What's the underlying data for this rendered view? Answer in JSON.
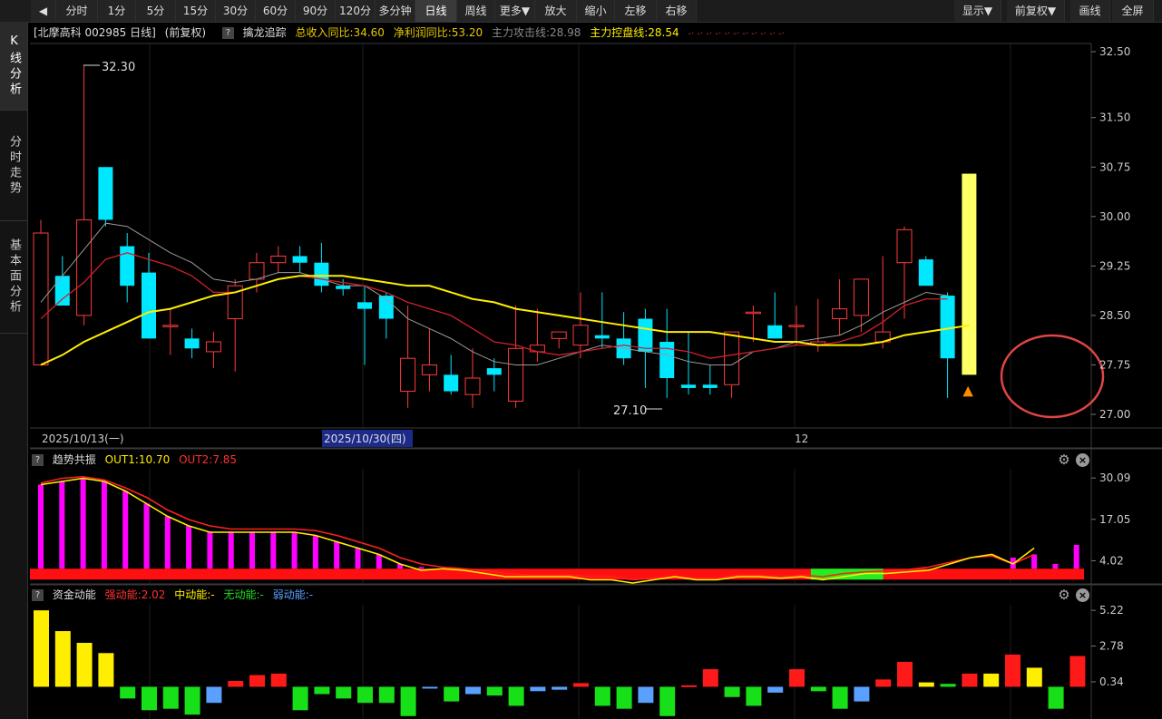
{
  "toolbar": {
    "back": "◀",
    "periods": [
      "分时",
      "1分",
      "5分",
      "15分",
      "30分",
      "60分",
      "90分",
      "120分",
      "多分钟",
      "日线",
      "周线",
      "更多▼"
    ],
    "actions": [
      "放大",
      "缩小",
      "左移",
      "右移"
    ],
    "right": [
      "显示▼",
      "前复权▼",
      "画线",
      "全屏"
    ]
  },
  "sidebar": [
    {
      "label": "K线分析",
      "active": true
    },
    {
      "label": "分时走势",
      "active": false
    },
    {
      "label": "基本面分析",
      "active": false
    }
  ],
  "header": {
    "stock": "[北摩高科 002985 日线]",
    "adjust": "(前复权)",
    "q": "?",
    "indicator": "擒龙追踪",
    "revenue": "总收入同比:34.60",
    "profit": "净利润同比:53.20",
    "attack": "主力攻击线:28.98",
    "control": "主力控盘线:28.54",
    "dots": "-·  -·  -·  -·  -·  -·  -·  -·  -·  -·  -·"
  },
  "colors": {
    "up": "#ff3b3b",
    "down": "#00e8ff",
    "ma_slow": "#ffee00",
    "ma_fast": "#d0202a",
    "ma_mid": "#9a9a9a",
    "highlight": "#ffff66",
    "circle": "#e04545"
  },
  "price_axis": {
    "ticks": [
      "32.50",
      "31.50",
      "30.75",
      "30.00",
      "29.25",
      "28.50",
      "27.75",
      "27.00"
    ],
    "min": 27.0,
    "max": 32.5
  },
  "date_labels": [
    {
      "text": "2025/10/13(一)",
      "highlight": false
    },
    {
      "text": "2025/10/30(四)",
      "highlight": true
    },
    {
      "text": "12",
      "highlight": false
    }
  ],
  "annotations": {
    "high": "32.30",
    "low": "27.10"
  },
  "chart_data": {
    "type": "candlestick",
    "candles": [
      {
        "o": 27.75,
        "h": 29.95,
        "l": 27.75,
        "c": 29.75
      },
      {
        "o": 29.1,
        "h": 29.4,
        "l": 28.75,
        "c": 28.65
      },
      {
        "o": 28.5,
        "h": 32.3,
        "l": 28.35,
        "c": 29.95
      },
      {
        "o": 30.75,
        "h": 30.75,
        "l": 29.85,
        "c": 29.95
      },
      {
        "o": 29.55,
        "h": 29.75,
        "l": 28.7,
        "c": 28.95
      },
      {
        "o": 29.15,
        "h": 29.45,
        "l": 28.35,
        "c": 28.15
      },
      {
        "o": 28.35,
        "h": 28.6,
        "l": 27.9,
        "c": 28.35
      },
      {
        "o": 28.15,
        "h": 28.3,
        "l": 27.85,
        "c": 28.0
      },
      {
        "o": 27.95,
        "h": 28.25,
        "l": 27.7,
        "c": 28.1
      },
      {
        "o": 28.45,
        "h": 29.05,
        "l": 27.65,
        "c": 28.95
      },
      {
        "o": 29.05,
        "h": 29.45,
        "l": 28.85,
        "c": 29.3
      },
      {
        "o": 29.3,
        "h": 29.55,
        "l": 29.15,
        "c": 29.4
      },
      {
        "o": 29.4,
        "h": 29.55,
        "l": 29.15,
        "c": 29.3
      },
      {
        "o": 29.3,
        "h": 29.6,
        "l": 28.85,
        "c": 28.95
      },
      {
        "o": 28.95,
        "h": 29.05,
        "l": 28.8,
        "c": 28.9
      },
      {
        "o": 28.7,
        "h": 28.95,
        "l": 27.75,
        "c": 28.6
      },
      {
        "o": 28.8,
        "h": 28.85,
        "l": 28.15,
        "c": 28.45
      },
      {
        "o": 27.35,
        "h": 28.65,
        "l": 27.1,
        "c": 27.85
      },
      {
        "o": 27.6,
        "h": 28.3,
        "l": 27.35,
        "c": 27.75
      },
      {
        "o": 27.6,
        "h": 27.9,
        "l": 27.3,
        "c": 27.35
      },
      {
        "o": 27.3,
        "h": 28.0,
        "l": 27.1,
        "c": 27.55
      },
      {
        "o": 27.7,
        "h": 27.85,
        "l": 27.35,
        "c": 27.6
      },
      {
        "o": 27.2,
        "h": 28.65,
        "l": 27.1,
        "c": 28.0
      },
      {
        "o": 27.95,
        "h": 28.6,
        "l": 27.8,
        "c": 28.05
      },
      {
        "o": 28.15,
        "h": 28.25,
        "l": 28.0,
        "c": 28.25
      },
      {
        "o": 28.05,
        "h": 28.85,
        "l": 27.85,
        "c": 28.35
      },
      {
        "o": 28.2,
        "h": 28.85,
        "l": 28.0,
        "c": 28.15
      },
      {
        "o": 28.15,
        "h": 28.55,
        "l": 27.75,
        "c": 27.85
      },
      {
        "o": 28.45,
        "h": 28.6,
        "l": 27.4,
        "c": 27.95
      },
      {
        "o": 28.1,
        "h": 28.6,
        "l": 27.25,
        "c": 27.55
      },
      {
        "o": 27.45,
        "h": 28.25,
        "l": 27.3,
        "c": 27.4
      },
      {
        "o": 27.45,
        "h": 27.75,
        "l": 27.3,
        "c": 27.4
      },
      {
        "o": 27.45,
        "h": 28.2,
        "l": 27.25,
        "c": 28.25
      },
      {
        "o": 28.55,
        "h": 28.65,
        "l": 28.1,
        "c": 28.55
      },
      {
        "o": 28.35,
        "h": 28.85,
        "l": 28.15,
        "c": 28.15
      },
      {
        "o": 28.35,
        "h": 28.65,
        "l": 28.05,
        "c": 28.35
      },
      {
        "o": 28.05,
        "h": 28.75,
        "l": 27.95,
        "c": 28.1
      },
      {
        "o": 28.45,
        "h": 29.05,
        "l": 28.2,
        "c": 28.6
      },
      {
        "o": 28.5,
        "h": 28.85,
        "l": 28.25,
        "c": 29.05
      },
      {
        "o": 28.1,
        "h": 29.4,
        "l": 28.0,
        "c": 28.25
      },
      {
        "o": 29.3,
        "h": 29.85,
        "l": 28.45,
        "c": 29.8
      },
      {
        "o": 29.35,
        "h": 29.4,
        "l": 28.95,
        "c": 28.95
      },
      {
        "o": 28.8,
        "h": 28.85,
        "l": 27.25,
        "c": 27.85
      }
    ],
    "ma_slow": [
      27.75,
      27.9,
      28.1,
      28.25,
      28.4,
      28.55,
      28.6,
      28.7,
      28.8,
      28.85,
      28.95,
      29.05,
      29.1,
      29.1,
      29.1,
      29.05,
      29.0,
      28.95,
      28.95,
      28.85,
      28.75,
      28.7,
      28.6,
      28.55,
      28.5,
      28.45,
      28.4,
      28.35,
      28.3,
      28.25,
      28.25,
      28.25,
      28.2,
      28.15,
      28.1,
      28.1,
      28.05,
      28.05,
      28.05,
      28.1,
      28.2,
      28.25,
      28.3,
      28.35
    ],
    "ma_fast": [
      28.45,
      28.75,
      29.0,
      29.35,
      29.45,
      29.35,
      29.25,
      29.1,
      28.85,
      28.85,
      28.95,
      29.05,
      29.1,
      29.05,
      29.0,
      28.95,
      28.85,
      28.7,
      28.6,
      28.5,
      28.3,
      28.1,
      28.05,
      27.95,
      27.9,
      27.95,
      28.0,
      28.05,
      28.0,
      28.0,
      27.95,
      27.85,
      27.9,
      27.95,
      28.0,
      28.05,
      28.05,
      28.1,
      28.2,
      28.4,
      28.65,
      28.75,
      28.75
    ],
    "ma_mid": [
      28.7,
      29.1,
      29.5,
      29.9,
      29.85,
      29.65,
      29.45,
      29.3,
      29.05,
      29.0,
      29.05,
      29.15,
      29.15,
      29.05,
      28.95,
      28.95,
      28.75,
      28.45,
      28.3,
      28.15,
      27.95,
      27.8,
      27.75,
      27.75,
      27.85,
      27.95,
      28.05,
      28.0,
      27.95,
      27.9,
      27.8,
      27.75,
      27.75,
      27.95,
      28.0,
      28.1,
      28.15,
      28.2,
      28.35,
      28.55,
      28.7,
      28.85,
      28.8
    ],
    "highlight_bar": {
      "from": 27.6,
      "to": 30.65
    }
  },
  "trend_panel": {
    "q": "?",
    "name": "趋势共振",
    "out1": "OUT1:10.70",
    "out2": "OUT2:7.85",
    "ticks": [
      "30.09",
      "17.05",
      "4.02"
    ],
    "min": -3.0,
    "max": 33.0,
    "bars": [
      28,
      29,
      30,
      29,
      26,
      22,
      18,
      15,
      13,
      13,
      13,
      13,
      13,
      12,
      10,
      8,
      6,
      3,
      2,
      0,
      0,
      0,
      0,
      0,
      0,
      0,
      0,
      0,
      0,
      0,
      0,
      0,
      0,
      0,
      0,
      0,
      0,
      0,
      0,
      0,
      0,
      0,
      0,
      0,
      0,
      0,
      5,
      6,
      3,
      9
    ],
    "out1_line": [
      28,
      29,
      30,
      29,
      26,
      22,
      18,
      15,
      13,
      13,
      13,
      13,
      13,
      12,
      10,
      8,
      6,
      3,
      1,
      1.5,
      1,
      0,
      -1,
      -1,
      -1,
      -1,
      -2,
      -2,
      -3,
      -2,
      -1,
      -2,
      -2,
      -1,
      -1,
      -1.5,
      -1,
      -2,
      -1,
      0,
      0,
      0.5,
      1,
      3,
      5,
      6,
      3,
      8
    ],
    "out2_line": [
      28.5,
      30,
      30.5,
      29.5,
      27,
      24,
      20,
      17,
      15,
      14,
      14,
      14,
      14,
      13.5,
      12,
      10,
      8,
      5,
      3,
      2,
      1.5,
      1,
      0,
      -0.5,
      -0.5,
      -0.5,
      -1,
      -1,
      -2,
      -1.5,
      -1,
      -1.5,
      -1.5,
      -0.5,
      -0.5,
      -1,
      -0.5,
      -1,
      0,
      0.5,
      0.8,
      1.2,
      2,
      3.5,
      5,
      5.5,
      3,
      6
    ],
    "green_band": {
      "from": 36,
      "to": 39
    }
  },
  "money_panel": {
    "q": "?",
    "name": "资金动能",
    "strong": "强动能:2.02",
    "mid": "中动能:-",
    "none": "无动能:-",
    "weak": "弱动能:-",
    "ticks": [
      "5.22",
      "2.78",
      "0.34"
    ],
    "min": -2.2,
    "max": 5.6,
    "bars": [
      {
        "v": 5.22,
        "c": "yellow"
      },
      {
        "v": 3.8,
        "c": "yellow"
      },
      {
        "v": 3.0,
        "c": "yellow"
      },
      {
        "v": 2.3,
        "c": "yellow"
      },
      {
        "v": -0.8,
        "c": "green"
      },
      {
        "v": -1.6,
        "c": "green"
      },
      {
        "v": -1.5,
        "c": "green"
      },
      {
        "v": -1.9,
        "c": "green"
      },
      {
        "v": -1.1,
        "c": "blue"
      },
      {
        "v": 0.4,
        "c": "red"
      },
      {
        "v": 0.8,
        "c": "red"
      },
      {
        "v": 0.9,
        "c": "red"
      },
      {
        "v": -1.6,
        "c": "green"
      },
      {
        "v": -0.5,
        "c": "green"
      },
      {
        "v": -0.8,
        "c": "green"
      },
      {
        "v": -1.1,
        "c": "green"
      },
      {
        "v": -1.1,
        "c": "green"
      },
      {
        "v": -2.0,
        "c": "green"
      },
      {
        "v": -0.1,
        "c": "blue"
      },
      {
        "v": -1.0,
        "c": "green"
      },
      {
        "v": -0.5,
        "c": "blue"
      },
      {
        "v": -0.6,
        "c": "green"
      },
      {
        "v": -1.3,
        "c": "green"
      },
      {
        "v": -0.3,
        "c": "blue"
      },
      {
        "v": -0.2,
        "c": "blue"
      },
      {
        "v": 0.25,
        "c": "red"
      },
      {
        "v": -1.3,
        "c": "green"
      },
      {
        "v": -1.5,
        "c": "green"
      },
      {
        "v": -1.1,
        "c": "blue"
      },
      {
        "v": -2.0,
        "c": "green"
      },
      {
        "v": 0.1,
        "c": "red"
      },
      {
        "v": 1.2,
        "c": "red"
      },
      {
        "v": -0.7,
        "c": "green"
      },
      {
        "v": -1.3,
        "c": "green"
      },
      {
        "v": -0.4,
        "c": "blue"
      },
      {
        "v": 1.2,
        "c": "red"
      },
      {
        "v": -0.3,
        "c": "green"
      },
      {
        "v": -1.5,
        "c": "green"
      },
      {
        "v": -1.0,
        "c": "blue"
      },
      {
        "v": 0.5,
        "c": "red"
      },
      {
        "v": 1.7,
        "c": "red"
      },
      {
        "v": 0.3,
        "c": "yellow"
      },
      {
        "v": 0.2,
        "c": "green"
      },
      {
        "v": 0.9,
        "c": "red"
      },
      {
        "v": 0.9,
        "c": "yellow"
      },
      {
        "v": 2.2,
        "c": "red"
      },
      {
        "v": 1.3,
        "c": "yellow"
      },
      {
        "v": -1.5,
        "c": "green"
      },
      {
        "v": 2.1,
        "c": "red"
      }
    ]
  }
}
